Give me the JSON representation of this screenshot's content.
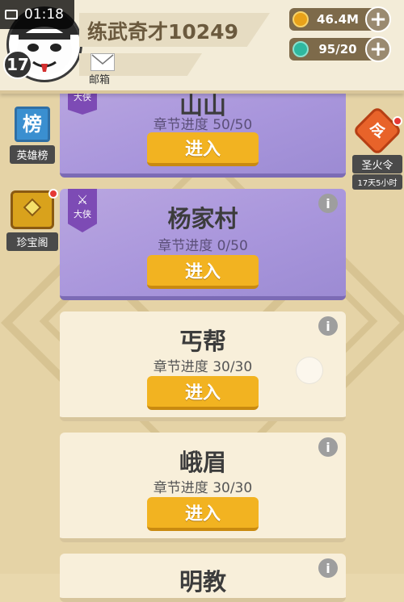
{
  "status": {
    "time": "01:18"
  },
  "player": {
    "name": "练武奇才10249",
    "level": "17"
  },
  "mail": {
    "label": "邮箱"
  },
  "resources": [
    {
      "name": "coin",
      "value": "46.4M",
      "icon": "coin-icon",
      "color": "#e8a21a"
    },
    {
      "name": "gem",
      "value": "95/20",
      "icon": "gem-icon",
      "color": "#2fb8a0"
    }
  ],
  "side_left": [
    {
      "label": "英雄榜",
      "icon": "hero-rank-icon",
      "glyph": "榜"
    },
    {
      "label": "珍宝阁",
      "icon": "treasure-chest-icon"
    }
  ],
  "side_right": {
    "label": "圣火令",
    "sub": "17天5小时",
    "glyph": "令",
    "icon": "holy-fire-token-icon"
  },
  "rank_badge": "大侠",
  "enter_label": "进入",
  "chapters": [
    {
      "title": "山山",
      "progress": "章节进度 50/50",
      "style": "purple"
    },
    {
      "title": "杨家村",
      "progress": "章节进度 0/50",
      "style": "purple"
    },
    {
      "title": "丐帮",
      "progress": "章节进度 30/30",
      "style": "cream"
    },
    {
      "title": "峨眉",
      "progress": "章节进度 30/30",
      "style": "cream"
    },
    {
      "title": "明教",
      "progress": "",
      "style": "cream"
    }
  ]
}
